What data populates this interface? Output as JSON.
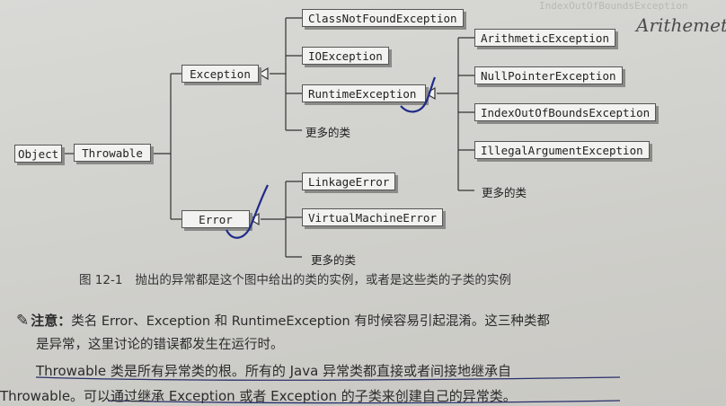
{
  "diagram": {
    "nodes": {
      "object": "Object",
      "throwable": "Throwable",
      "exception": "Exception",
      "error": "Error",
      "class_not_found": "ClassNotFoundException",
      "io_exception": "IOException",
      "runtime_exception": "RuntimeException",
      "arithmetic": "ArithmeticException",
      "null_pointer": "NullPointerException",
      "index_out_of_bounds": "IndexOutOfBoundsException",
      "illegal_argument": "IllegalArgumentException",
      "linkage_error": "LinkageError",
      "vm_error": "VirtualMachineError"
    },
    "more_label": "更多的类"
  },
  "caption": {
    "number": "图 12-1",
    "text": "抛出的异常都是这个图中给出的类的实例，或者是这些类的子类的实例"
  },
  "note": {
    "title": "注意：",
    "line1": "类名 Error、Exception 和 RuntimeException 有时候容易引起混淆。这三种类都",
    "line2": "是异常，这里讨论的错误都发生在运行时。",
    "line3": "Throwable 类是所有异常类的根。所有的 Java 异常类都直接或者间接地继承自",
    "line4": "Throwable。可以通过继承 Exception 或者 Exception 的子类来创建自己的异常类。"
  },
  "handwriting": "Arithemet",
  "colors": {
    "pen": "#1f2a8a",
    "paper": "#d6d6d2",
    "box": "#f2f2f0"
  }
}
